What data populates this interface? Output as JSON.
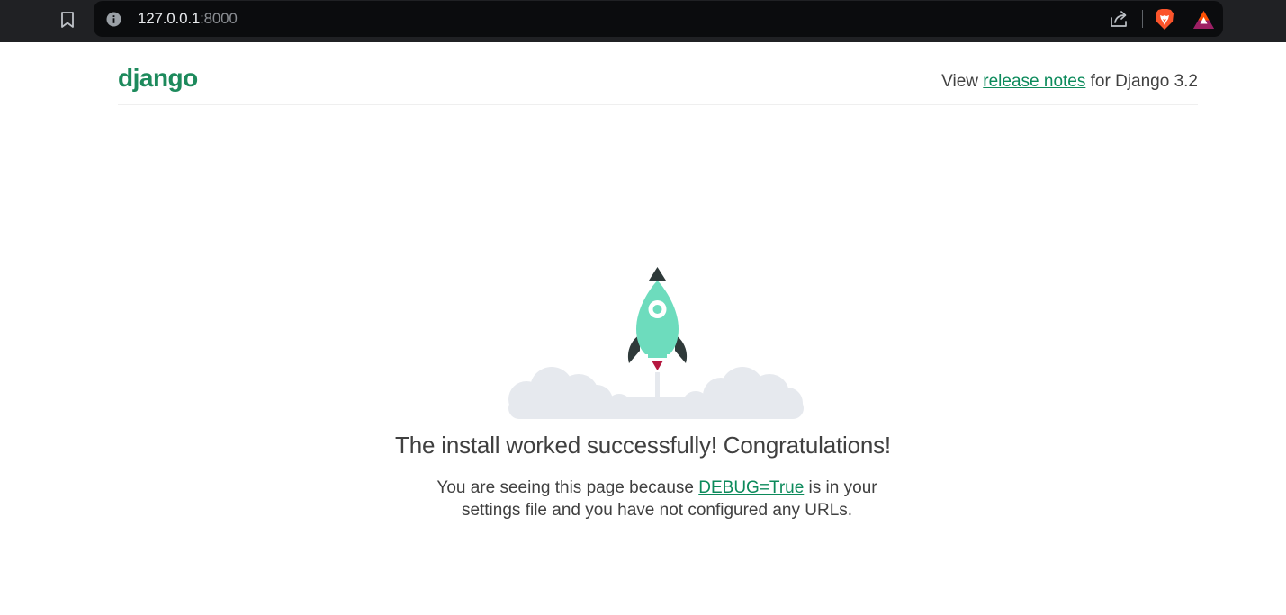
{
  "browser": {
    "url_host": "127.0.0.1",
    "url_port": ":8000",
    "icons": [
      "bookmark-icon",
      "info-icon",
      "share-icon",
      "brave-shield-icon",
      "brave-rewards-icon"
    ]
  },
  "header": {
    "logo": "django",
    "release_prefix": "View ",
    "release_link": "release notes",
    "release_suffix": " for Django 3.2"
  },
  "main": {
    "title": "The install worked successfully! Congratulations!",
    "desc_prefix": "You are seeing this page because ",
    "desc_link": "DEBUG=True",
    "desc_suffix": " is in your settings file and you have not configured any URLs."
  },
  "colors": {
    "brand_green": "#1d8a5c",
    "link_green": "#0c8a5b",
    "rocket_body": "#6ddcbd",
    "rocket_dark": "#2f3a3a",
    "cloud": "#e6e9ee",
    "chrome_bg": "#202124"
  }
}
